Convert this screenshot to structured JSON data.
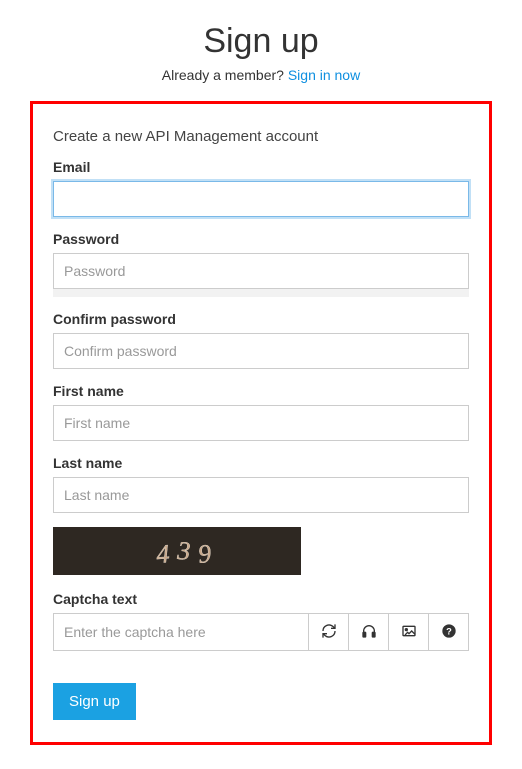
{
  "header": {
    "title": "Sign up",
    "subtitle_prefix": "Already a member? ",
    "signin_link": "Sign in now"
  },
  "form": {
    "heading": "Create a new API Management account",
    "email": {
      "label": "Email",
      "value": ""
    },
    "password": {
      "label": "Password",
      "placeholder": "Password",
      "value": ""
    },
    "confirm_password": {
      "label": "Confirm password",
      "placeholder": "Confirm password",
      "value": ""
    },
    "first_name": {
      "label": "First name",
      "placeholder": "First name",
      "value": ""
    },
    "last_name": {
      "label": "Last name",
      "placeholder": "Last name",
      "value": ""
    },
    "captcha": {
      "image_text": "439",
      "label": "Captcha text",
      "placeholder": "Enter the captcha here",
      "value": ""
    },
    "submit_label": "Sign up"
  },
  "icons": {
    "refresh": "refresh-icon",
    "audio": "headphones-icon",
    "image": "image-icon",
    "help": "help-icon"
  }
}
